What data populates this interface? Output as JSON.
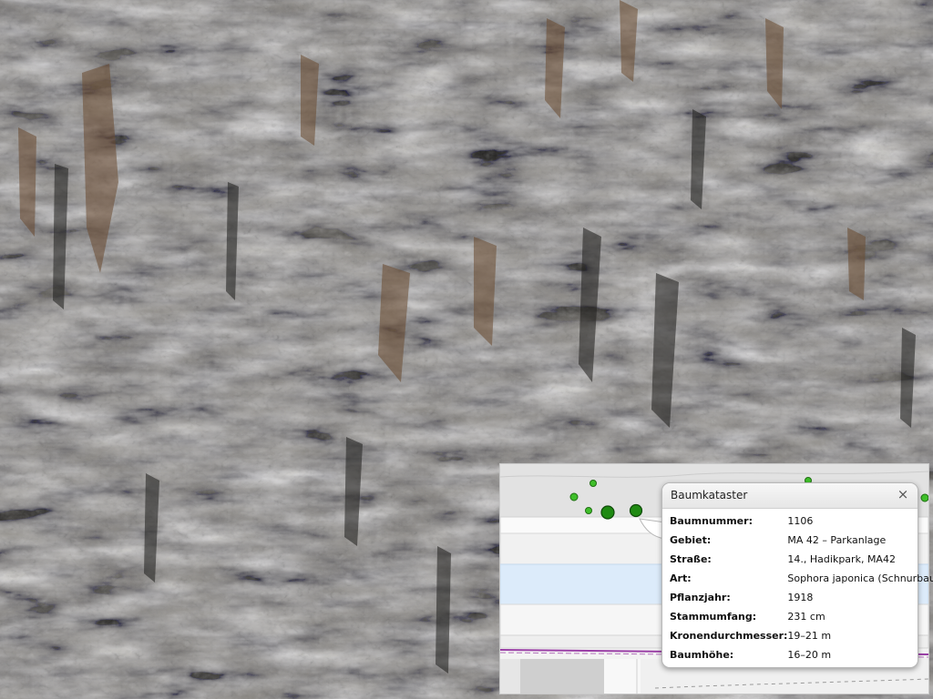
{
  "popup": {
    "title": "Baumkataster",
    "close_glyph": "×",
    "rows": [
      {
        "label": "Baumnummer:",
        "value": "1106"
      },
      {
        "label": "Gebiet:",
        "value": "MA 42 – Parkanlage"
      },
      {
        "label": "Straße:",
        "value": "14., Hadikpark, MA42"
      },
      {
        "label": "Art:",
        "value": "Sophora japonica (Schnurbaum)"
      },
      {
        "label": "Pflanzjahr:",
        "value": "1918"
      },
      {
        "label": "Stammumfang:",
        "value": "231 cm"
      },
      {
        "label": "Kronendurchmesser:",
        "value": "19–21 m"
      },
      {
        "label": "Baumhöhe:",
        "value": "16–20 m"
      }
    ]
  },
  "colors": {
    "tree_marker": "#3fbf2a",
    "tree_marker_dark": "#1f7d12",
    "water": "#dcebfa",
    "boundary": "#9a3fa6"
  },
  "icons": {
    "close": "close-icon",
    "marker": "tree-marker-icon"
  }
}
